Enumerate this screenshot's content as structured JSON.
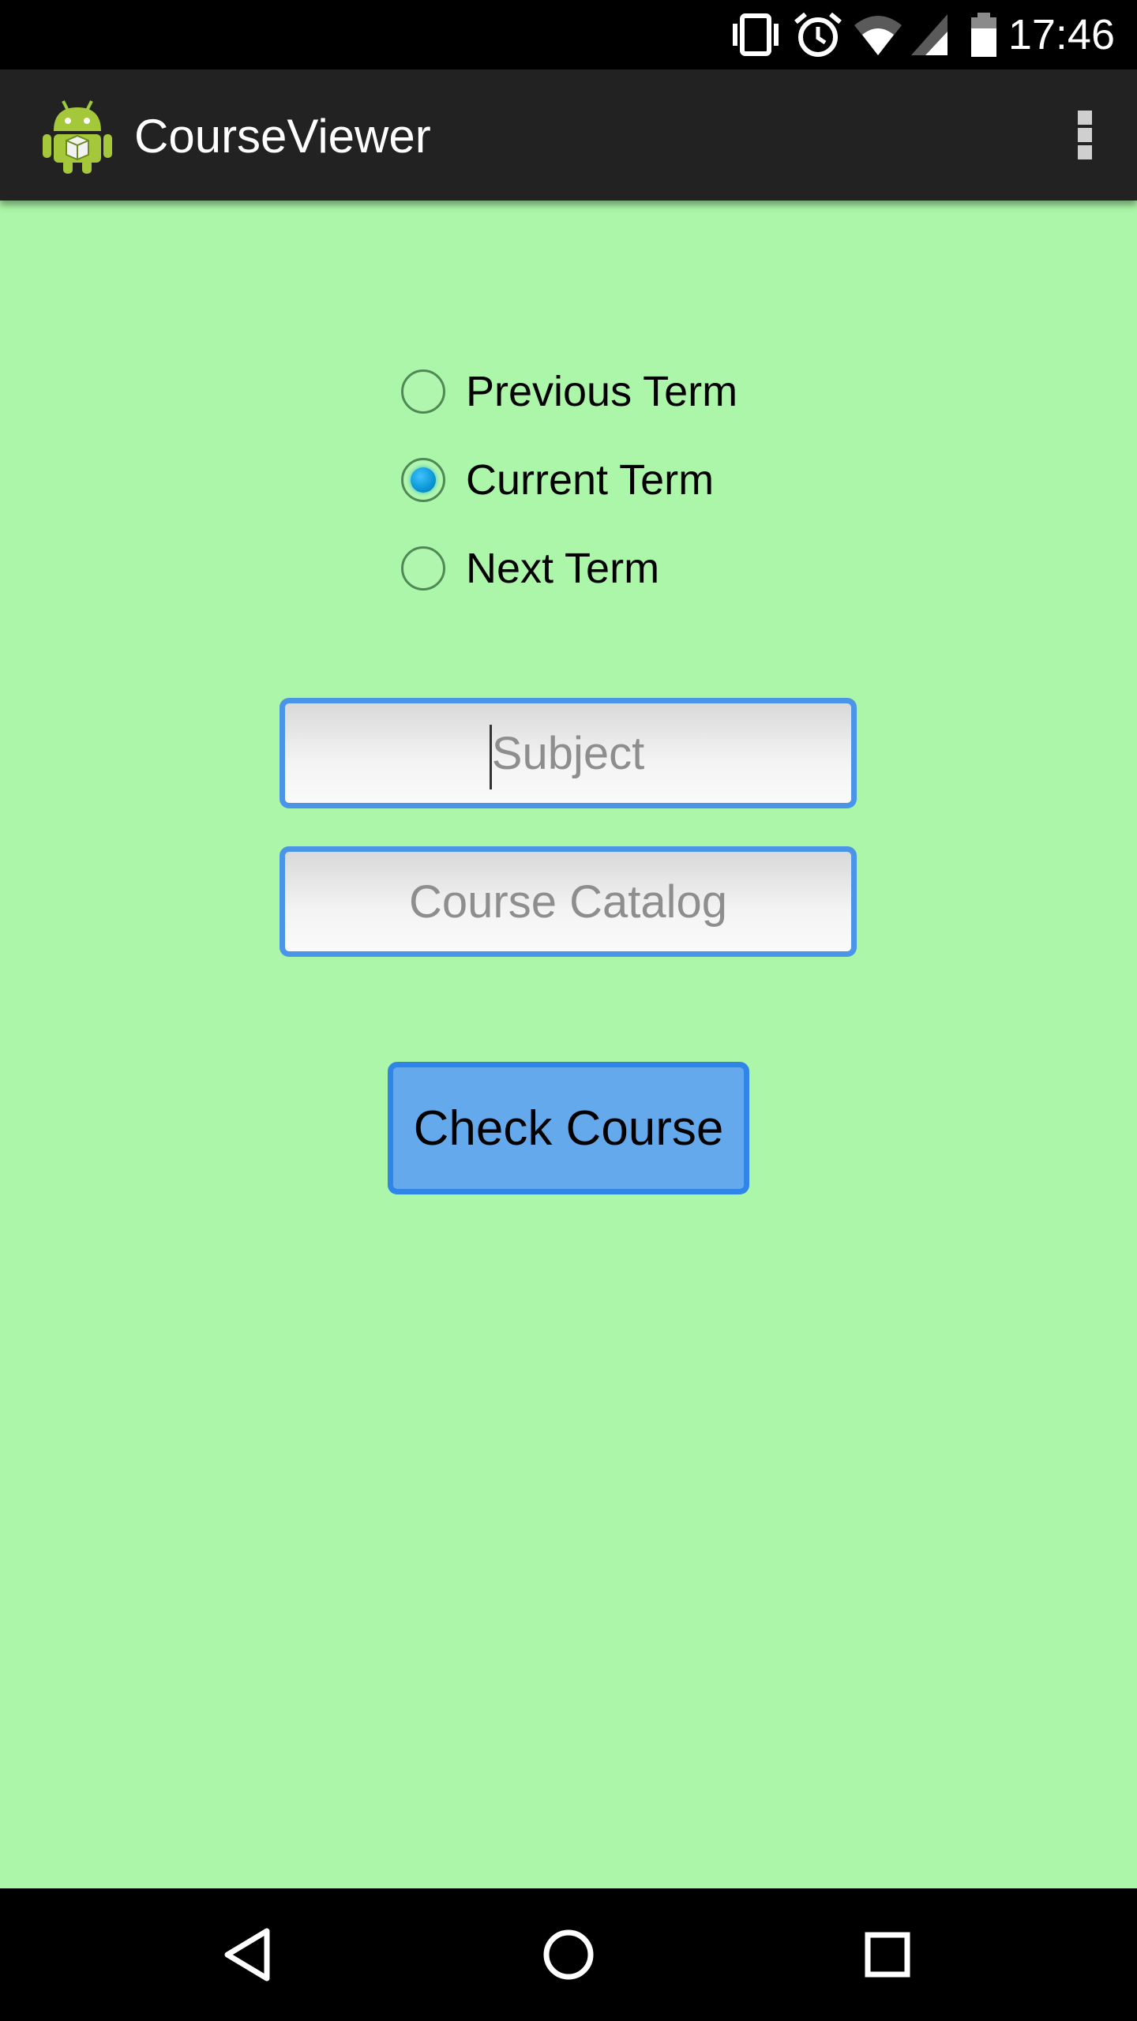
{
  "status_bar": {
    "time": "17:46",
    "icons": [
      "vibrate-icon",
      "alarm-icon",
      "wifi-icon",
      "cell-signal-icon",
      "battery-icon"
    ]
  },
  "action_bar": {
    "app_icon": "android-robot-icon",
    "title": "CourseViewer",
    "overflow_icon": "overflow-menu-icon"
  },
  "term_options": [
    {
      "label": "Previous Term",
      "checked": false
    },
    {
      "label": "Current Term",
      "checked": true
    },
    {
      "label": "Next Term",
      "checked": false
    }
  ],
  "subject_field": {
    "placeholder": "Subject",
    "value": ""
  },
  "catalog_field": {
    "placeholder": "Course Catalog",
    "value": ""
  },
  "check_button": {
    "label": "Check Course"
  },
  "nav_bar": {
    "buttons": [
      "back-icon",
      "home-icon",
      "recents-icon"
    ]
  },
  "colors": {
    "background": "#abf6a8",
    "action_bar": "#222222",
    "accent_border": "#4a95e8",
    "button_fill": "#64a9ec",
    "radio_selected": "#0a96d4"
  }
}
